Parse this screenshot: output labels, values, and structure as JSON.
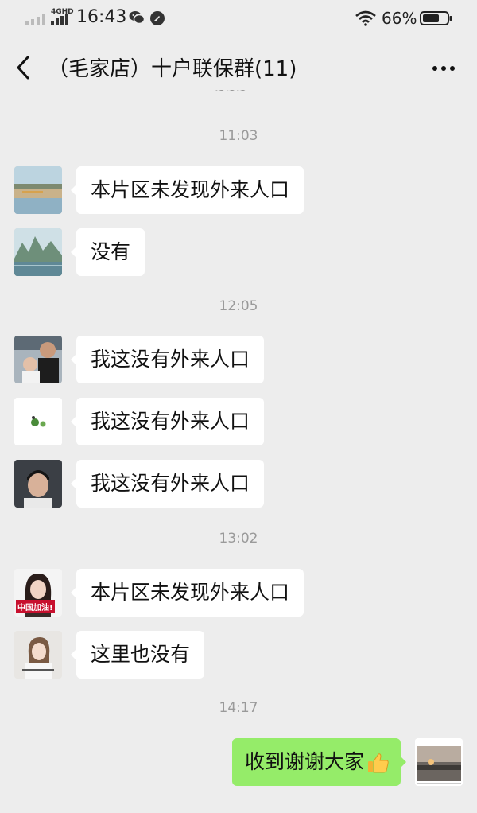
{
  "status_bar": {
    "network": "4GHD",
    "time": "16:43",
    "battery": "66%"
  },
  "header": {
    "title": "（毛家店）十户联保群(11)"
  },
  "messages": {
    "t1": "11:03",
    "m1": "本片区未发现外来人口",
    "m2": "没有",
    "t2": "12:05",
    "m3": "我这没有外来人口",
    "m4": "我这没有外来人口",
    "m5": "我这没有外来人口",
    "t3": "13:02",
    "m6": "本片区未发现外来人口",
    "m6_avatar_caption": "中国加油!",
    "m7": "这里也没有",
    "t4": "14:17",
    "m8": "收到谢谢大家"
  },
  "icons": {
    "back": "back-arrow-icon",
    "more": "more-dots-icon",
    "thumbs_up": "thumbs-up-emoji"
  }
}
